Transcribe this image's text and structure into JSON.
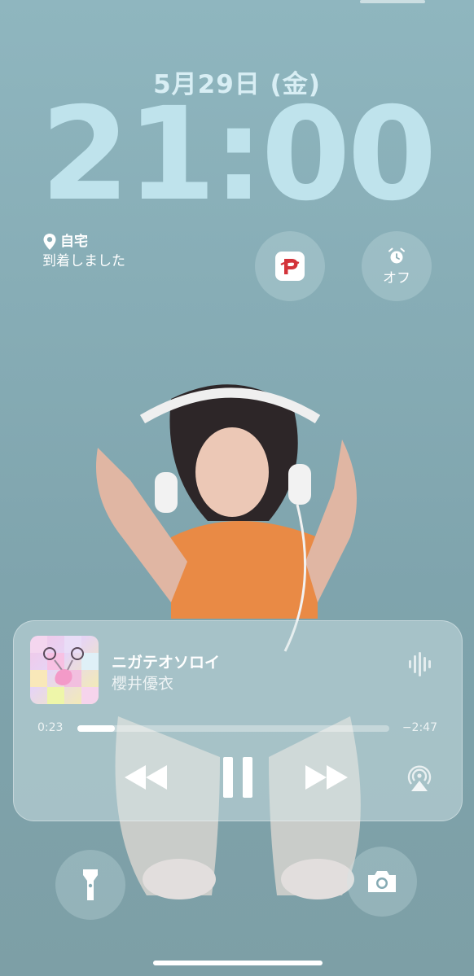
{
  "lockscreen": {
    "date": "5月29日 (金)",
    "time": "21:00",
    "location": {
      "place": "自宅",
      "status": "到着しました"
    },
    "widgets": {
      "paypay_icon": "paypay-icon",
      "alarm_icon": "alarm-clock-icon",
      "alarm_label": "オフ"
    }
  },
  "now_playing": {
    "title": "ニガテオソロイ",
    "artist": "櫻井優衣",
    "elapsed": "0:23",
    "remaining": "−2:47",
    "progress": 0.12,
    "controls": {
      "previous": "rewind-icon",
      "play_pause": "pause-icon",
      "next": "fast-forward-icon",
      "output": "airplay-icon",
      "visualizer": "waveform-icon"
    }
  },
  "quick_actions": {
    "left": "flashlight-icon",
    "right": "camera-icon"
  },
  "colors": {
    "clock": "#bfe3ec",
    "background": "#86abb4",
    "accent_orange": "#e98a45"
  }
}
